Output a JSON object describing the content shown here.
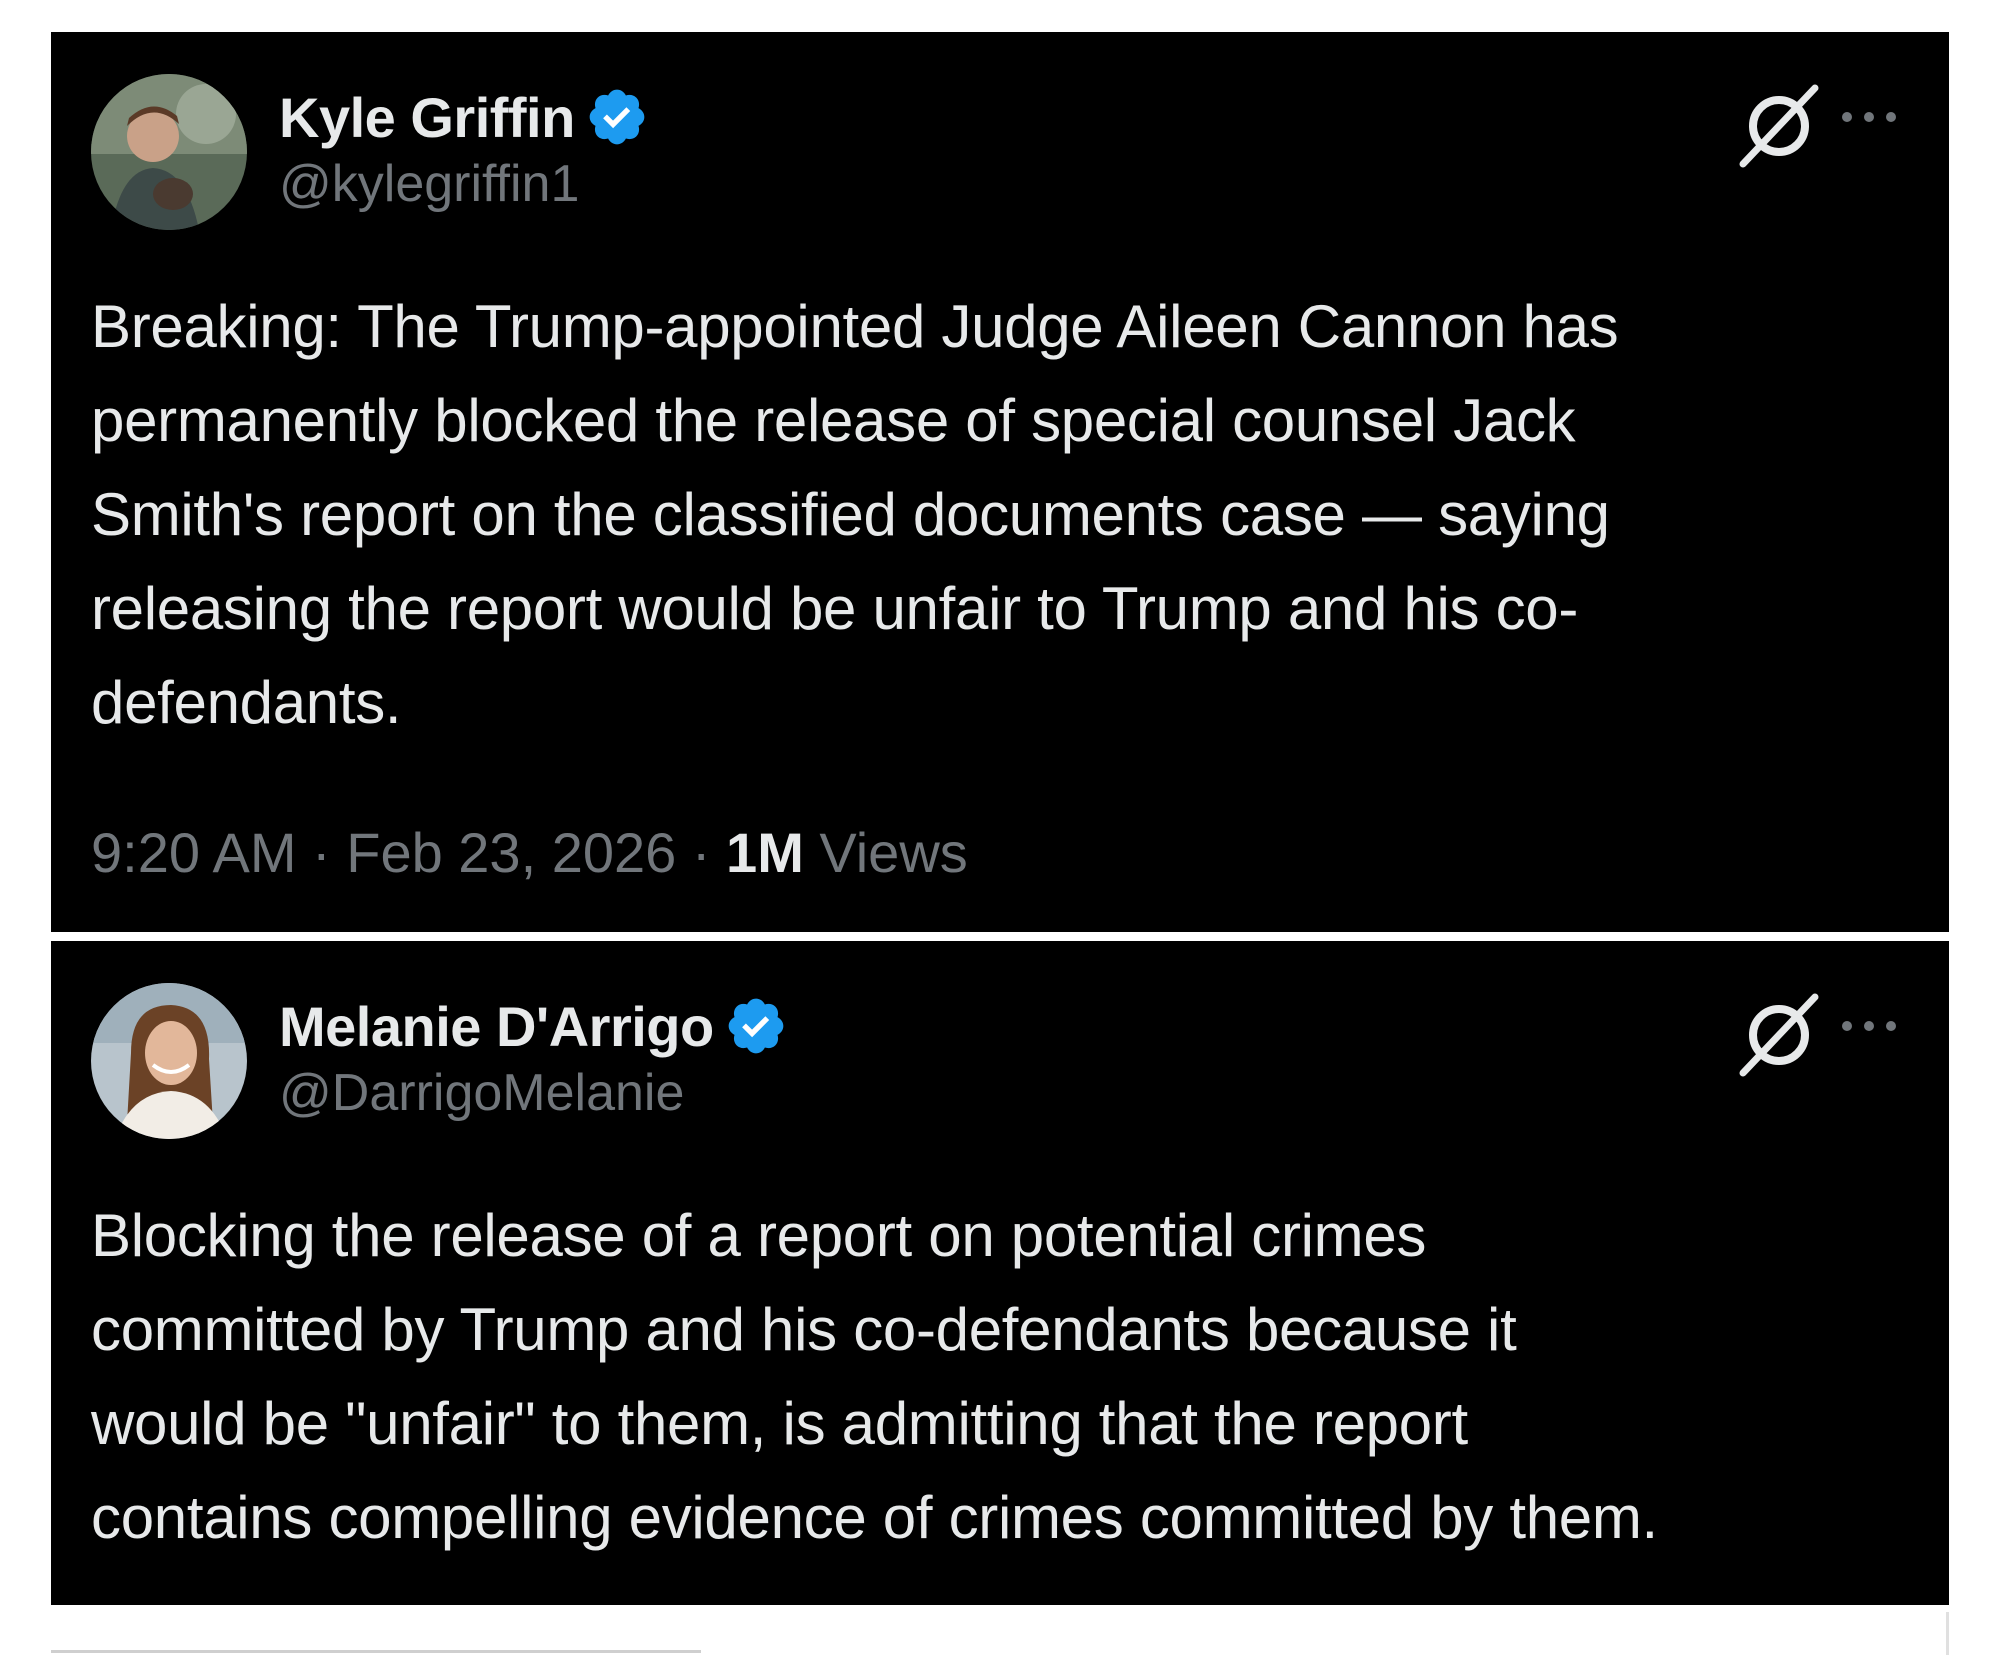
{
  "colors": {
    "background": "#000000",
    "text_primary": "#e7e9ea",
    "text_secondary": "#71767b",
    "verified_badge": "#1d9bf0"
  },
  "tweets": [
    {
      "author": {
        "display_name": "Kyle Griffin",
        "handle": "@kylegriffin1",
        "verified": true
      },
      "body_lines": [
        "Breaking: The Trump-appointed Judge Aileen Cannon has",
        "permanently blocked the release of special counsel Jack",
        "Smith's report on the classified documents case — saying",
        "releasing the report would be unfair to Trump and his co-",
        "defendants."
      ],
      "meta": {
        "time": "9:20 AM",
        "separator": " · ",
        "date": "Feb 23, 2026",
        "views_count": "1M",
        "views_label": " Views"
      },
      "icons": [
        "grok-icon",
        "more-options-icon"
      ]
    },
    {
      "author": {
        "display_name": "Melanie D'Arrigo",
        "handle": "@DarrigoMelanie",
        "verified": true
      },
      "body_lines": [
        "Blocking the release of a report on potential crimes",
        "committed by Trump and his co-defendants because it",
        "would be \"unfair\" to them, is admitting that the report",
        "contains compelling evidence of crimes committed by them."
      ],
      "icons": [
        "grok-icon",
        "more-options-icon"
      ]
    }
  ]
}
